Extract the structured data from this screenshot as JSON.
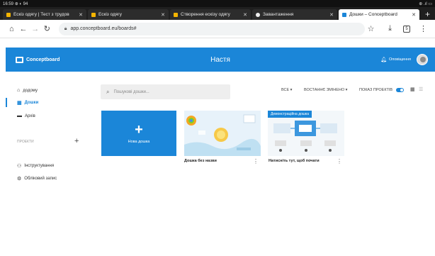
{
  "status_bar": {
    "time": "16:59",
    "notif": "⊕ ◐ 94",
    "right": "⊕ .ıl ▭"
  },
  "tabs": [
    {
      "title": "Ескіз одягу | Тест з трудов",
      "close": "✕",
      "icon_color": "#f4b400"
    },
    {
      "title": "Ескіз одягу",
      "close": "✕",
      "icon_color": "#f4b400"
    },
    {
      "title": "Створення ескізу одягу",
      "close": "✕",
      "icon_color": "#f4b400"
    },
    {
      "title": "Завантаження",
      "close": "✕",
      "icon_color": "#eeeeee"
    },
    {
      "title": "Дошки – Conceptboard",
      "close": "✕",
      "icon_color": "#1b86d8",
      "active": true
    }
  ],
  "new_tab": "+",
  "address_bar": {
    "url": "app.conceptboard.eu/boards#",
    "tab_count": "5"
  },
  "header": {
    "logo": "Conceptboard",
    "title": "Настя",
    "notifications": "Оповіщення"
  },
  "sidebar": {
    "home": "додому",
    "boards": "Дошки",
    "archive": "Архів",
    "projects_header": "ПРОЕКТИ",
    "add_project": "+",
    "instructions": "Інструктування",
    "account": "Обліковий запис"
  },
  "search": {
    "placeholder": "Пошукові дошки..."
  },
  "filters": {
    "all": "ВСЕ ▾",
    "recent": "ВОСТАННЄ ЗМІНЕНО ▾",
    "show_projects": "ПОКАЗ ПРОЕКТІВ"
  },
  "boards": {
    "new": {
      "label": "Нова дошка"
    },
    "items": [
      {
        "title": "Дошка без назви"
      },
      {
        "title": "Натисніть тут, щоб почати",
        "badge": "Демонстраційна дошка"
      }
    ]
  },
  "colors": {
    "accent": "#1b86d8"
  }
}
